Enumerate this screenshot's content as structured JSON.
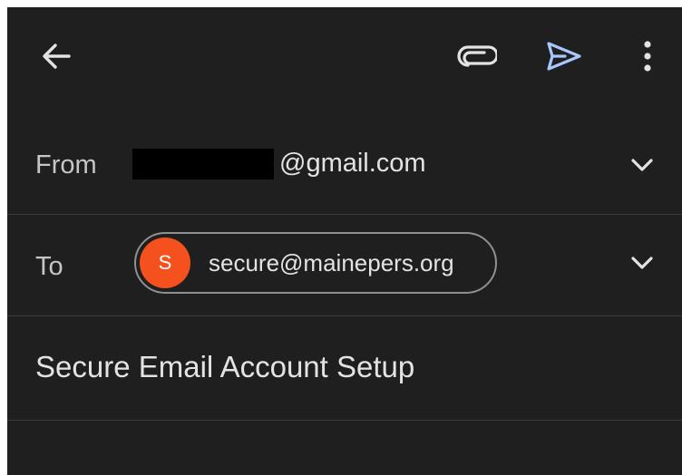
{
  "toolbar": {
    "back_icon": "arrow-back-icon",
    "attach_icon": "paperclip-icon",
    "send_icon": "send-icon",
    "more_icon": "more-vert-icon"
  },
  "compose": {
    "from": {
      "label": "From",
      "domain": "@gmail.com",
      "expand_icon": "chevron-down-icon"
    },
    "to": {
      "label": "To",
      "recipient": {
        "initial": "S",
        "email": "secure@mainepers.org",
        "avatar_color": "#f4511e"
      },
      "expand_icon": "chevron-down-icon"
    },
    "subject": "Secure Email Account Setup"
  },
  "colors": {
    "background": "#1f1f1f",
    "text": "#e3e3e3",
    "accent": "#a8c7fa",
    "divider": "#3c3c3c"
  }
}
